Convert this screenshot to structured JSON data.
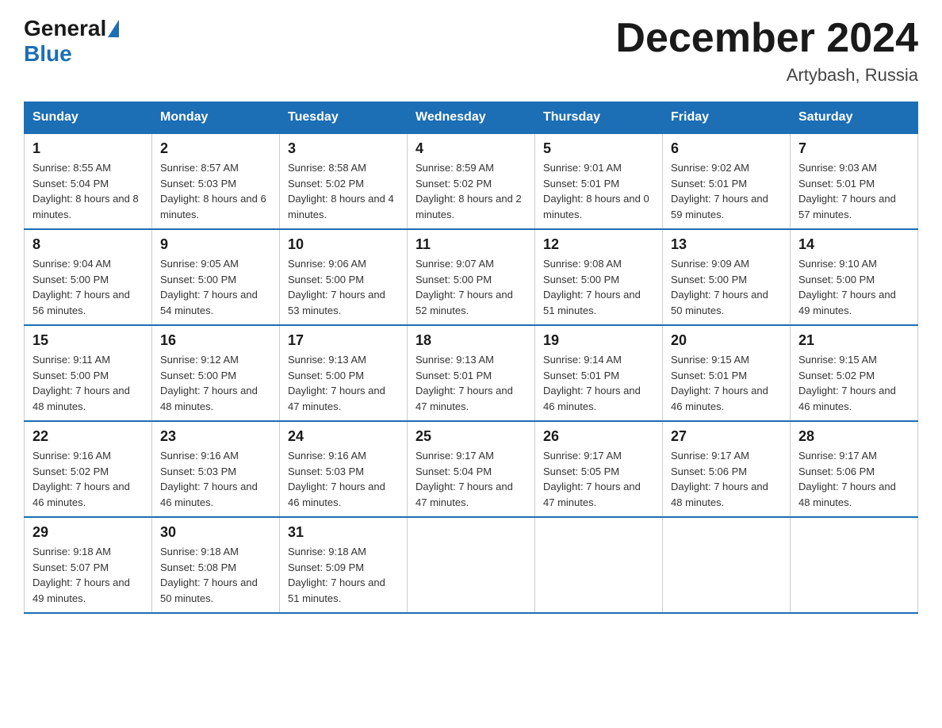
{
  "header": {
    "logo": {
      "general": "General",
      "blue": "Blue"
    },
    "title": "December 2024",
    "location": "Artybash, Russia"
  },
  "calendar": {
    "days_of_week": [
      "Sunday",
      "Monday",
      "Tuesday",
      "Wednesday",
      "Thursday",
      "Friday",
      "Saturday"
    ],
    "weeks": [
      [
        {
          "day": "1",
          "sunrise": "8:55 AM",
          "sunset": "5:04 PM",
          "daylight": "8 hours and 8 minutes."
        },
        {
          "day": "2",
          "sunrise": "8:57 AM",
          "sunset": "5:03 PM",
          "daylight": "8 hours and 6 minutes."
        },
        {
          "day": "3",
          "sunrise": "8:58 AM",
          "sunset": "5:02 PM",
          "daylight": "8 hours and 4 minutes."
        },
        {
          "day": "4",
          "sunrise": "8:59 AM",
          "sunset": "5:02 PM",
          "daylight": "8 hours and 2 minutes."
        },
        {
          "day": "5",
          "sunrise": "9:01 AM",
          "sunset": "5:01 PM",
          "daylight": "8 hours and 0 minutes."
        },
        {
          "day": "6",
          "sunrise": "9:02 AM",
          "sunset": "5:01 PM",
          "daylight": "7 hours and 59 minutes."
        },
        {
          "day": "7",
          "sunrise": "9:03 AM",
          "sunset": "5:01 PM",
          "daylight": "7 hours and 57 minutes."
        }
      ],
      [
        {
          "day": "8",
          "sunrise": "9:04 AM",
          "sunset": "5:00 PM",
          "daylight": "7 hours and 56 minutes."
        },
        {
          "day": "9",
          "sunrise": "9:05 AM",
          "sunset": "5:00 PM",
          "daylight": "7 hours and 54 minutes."
        },
        {
          "day": "10",
          "sunrise": "9:06 AM",
          "sunset": "5:00 PM",
          "daylight": "7 hours and 53 minutes."
        },
        {
          "day": "11",
          "sunrise": "9:07 AM",
          "sunset": "5:00 PM",
          "daylight": "7 hours and 52 minutes."
        },
        {
          "day": "12",
          "sunrise": "9:08 AM",
          "sunset": "5:00 PM",
          "daylight": "7 hours and 51 minutes."
        },
        {
          "day": "13",
          "sunrise": "9:09 AM",
          "sunset": "5:00 PM",
          "daylight": "7 hours and 50 minutes."
        },
        {
          "day": "14",
          "sunrise": "9:10 AM",
          "sunset": "5:00 PM",
          "daylight": "7 hours and 49 minutes."
        }
      ],
      [
        {
          "day": "15",
          "sunrise": "9:11 AM",
          "sunset": "5:00 PM",
          "daylight": "7 hours and 48 minutes."
        },
        {
          "day": "16",
          "sunrise": "9:12 AM",
          "sunset": "5:00 PM",
          "daylight": "7 hours and 48 minutes."
        },
        {
          "day": "17",
          "sunrise": "9:13 AM",
          "sunset": "5:00 PM",
          "daylight": "7 hours and 47 minutes."
        },
        {
          "day": "18",
          "sunrise": "9:13 AM",
          "sunset": "5:01 PM",
          "daylight": "7 hours and 47 minutes."
        },
        {
          "day": "19",
          "sunrise": "9:14 AM",
          "sunset": "5:01 PM",
          "daylight": "7 hours and 46 minutes."
        },
        {
          "day": "20",
          "sunrise": "9:15 AM",
          "sunset": "5:01 PM",
          "daylight": "7 hours and 46 minutes."
        },
        {
          "day": "21",
          "sunrise": "9:15 AM",
          "sunset": "5:02 PM",
          "daylight": "7 hours and 46 minutes."
        }
      ],
      [
        {
          "day": "22",
          "sunrise": "9:16 AM",
          "sunset": "5:02 PM",
          "daylight": "7 hours and 46 minutes."
        },
        {
          "day": "23",
          "sunrise": "9:16 AM",
          "sunset": "5:03 PM",
          "daylight": "7 hours and 46 minutes."
        },
        {
          "day": "24",
          "sunrise": "9:16 AM",
          "sunset": "5:03 PM",
          "daylight": "7 hours and 46 minutes."
        },
        {
          "day": "25",
          "sunrise": "9:17 AM",
          "sunset": "5:04 PM",
          "daylight": "7 hours and 47 minutes."
        },
        {
          "day": "26",
          "sunrise": "9:17 AM",
          "sunset": "5:05 PM",
          "daylight": "7 hours and 47 minutes."
        },
        {
          "day": "27",
          "sunrise": "9:17 AM",
          "sunset": "5:06 PM",
          "daylight": "7 hours and 48 minutes."
        },
        {
          "day": "28",
          "sunrise": "9:17 AM",
          "sunset": "5:06 PM",
          "daylight": "7 hours and 48 minutes."
        }
      ],
      [
        {
          "day": "29",
          "sunrise": "9:18 AM",
          "sunset": "5:07 PM",
          "daylight": "7 hours and 49 minutes."
        },
        {
          "day": "30",
          "sunrise": "9:18 AM",
          "sunset": "5:08 PM",
          "daylight": "7 hours and 50 minutes."
        },
        {
          "day": "31",
          "sunrise": "9:18 AM",
          "sunset": "5:09 PM",
          "daylight": "7 hours and 51 minutes."
        },
        null,
        null,
        null,
        null
      ]
    ]
  }
}
